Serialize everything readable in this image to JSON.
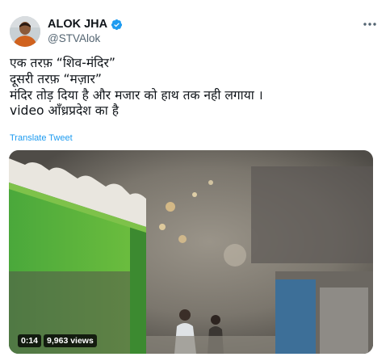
{
  "author": {
    "name": "ALOK JHA",
    "handle": "@STVAlok"
  },
  "tweet": {
    "lines": [
      "एक तरफ़ “शिव-मंदिर”",
      "दूसरी तरफ़ “मज़ार”",
      "मंदिर तोड़ दिया है और मजार को हाथ तक नही लगाया ।",
      "video आँध्रप्रदेश का है"
    ],
    "translate_label": "Translate Tweet"
  },
  "video": {
    "duration": "0:14",
    "views": "9,963 views"
  },
  "colors": {
    "link": "#1d9bf0",
    "verified": "#1d9bf0",
    "secondary_text": "#536471"
  },
  "icons": [
    "verified-badge-icon",
    "more-options-icon"
  ]
}
